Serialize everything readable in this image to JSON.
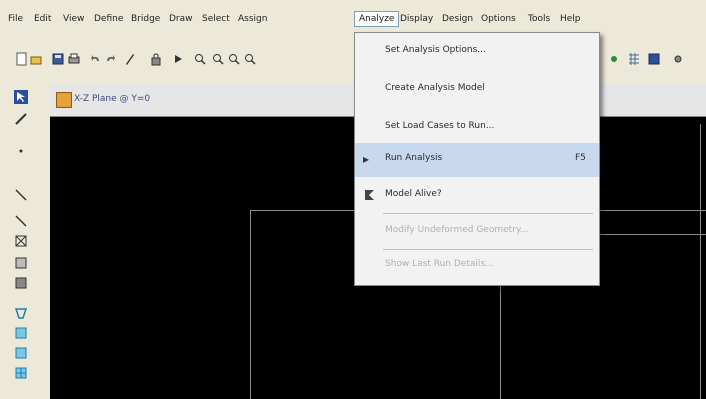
{
  "menubar": {
    "items": [
      "File",
      "Edit",
      "View",
      "Define",
      "Bridge",
      "Draw",
      "Select",
      "Assign",
      "Analyze",
      "Display",
      "Design",
      "Options",
      "Tools",
      "Help"
    ],
    "active": "Analyze"
  },
  "window": {
    "title": "X-Z Plane @ Y=0"
  },
  "analyze_menu": {
    "items": [
      {
        "label": "Set Analysis Options...",
        "shortcut": "",
        "enabled": true
      },
      {
        "label": "Create Analysis Model",
        "shortcut": "",
        "enabled": true
      },
      {
        "label": "Set Load Cases to Run...",
        "shortcut": "",
        "enabled": true
      },
      {
        "label": "Run Analysis",
        "shortcut": "F5",
        "enabled": true,
        "highlighted": true
      },
      {
        "label": "Model Alive?",
        "shortcut": "",
        "enabled": true
      },
      {
        "label": "Modify Undeformed Geometry...",
        "shortcut": "",
        "enabled": false
      },
      {
        "label": "Show Last Run Details...",
        "shortcut": "",
        "enabled": false
      }
    ]
  },
  "colors": {
    "highlight": "#c8d8ef",
    "canvas": "#000000",
    "chrome": "#ece9d8"
  }
}
